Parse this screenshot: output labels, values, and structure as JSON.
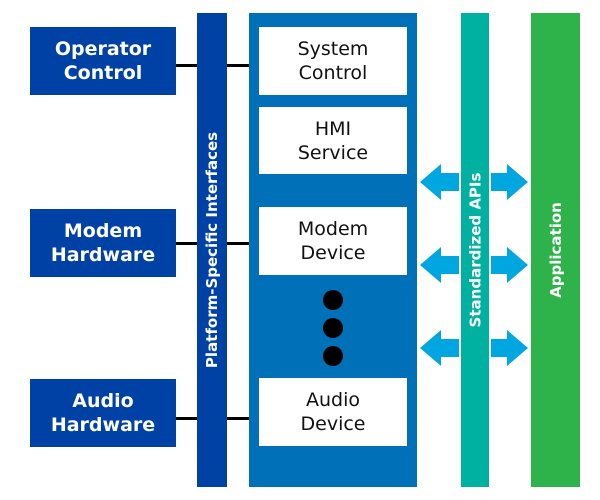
{
  "hardware": [
    {
      "label": "Operator Control"
    },
    {
      "label": "Modem Hardware"
    },
    {
      "label": "Audio Hardware"
    }
  ],
  "platform_interfaces": {
    "label": "Platform-Specific Interfaces",
    "color": "#0041a5"
  },
  "framework": {
    "color": "#0070b8",
    "modules": [
      {
        "label": "System Control"
      },
      {
        "label": "HMI Service"
      },
      {
        "label": "Modem Device"
      },
      {
        "label": "Audio Device"
      }
    ]
  },
  "standardized_apis": {
    "label": "Standardized APIs",
    "color": "#00b0a0"
  },
  "application": {
    "label": "Application",
    "color": "#2db34a"
  },
  "arrow_color": "#00a6e0"
}
